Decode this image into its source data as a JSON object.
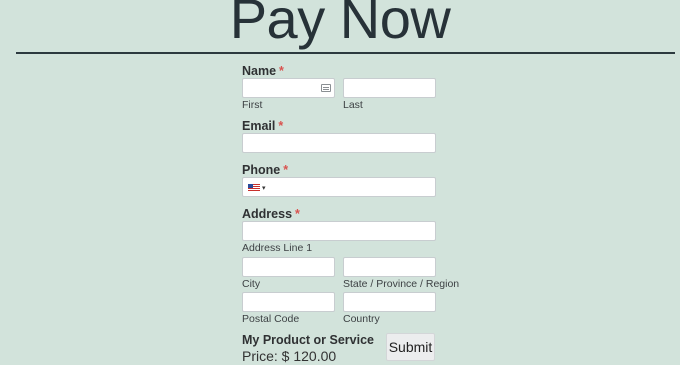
{
  "title": "Pay Now",
  "name": {
    "label": "Name",
    "required": "*",
    "first": "First",
    "last": "Last",
    "first_icon": "card-icon"
  },
  "email": {
    "label": "Email",
    "required": "*"
  },
  "phone": {
    "label": "Phone",
    "required": "*",
    "country_flag": "us-flag-icon",
    "caret": "▾"
  },
  "address": {
    "label": "Address",
    "required": "*",
    "line1": "Address Line 1",
    "city": "City",
    "state": "State / Province / Region",
    "postal": "Postal Code",
    "country": "Country"
  },
  "product": {
    "label": "My Product or Service",
    "price": "Price: $ 120.00"
  },
  "submit_label": "Submit",
  "colors": {
    "background": "#d2e3db",
    "required": "#d9534f",
    "rule": "#2c3a3f"
  }
}
